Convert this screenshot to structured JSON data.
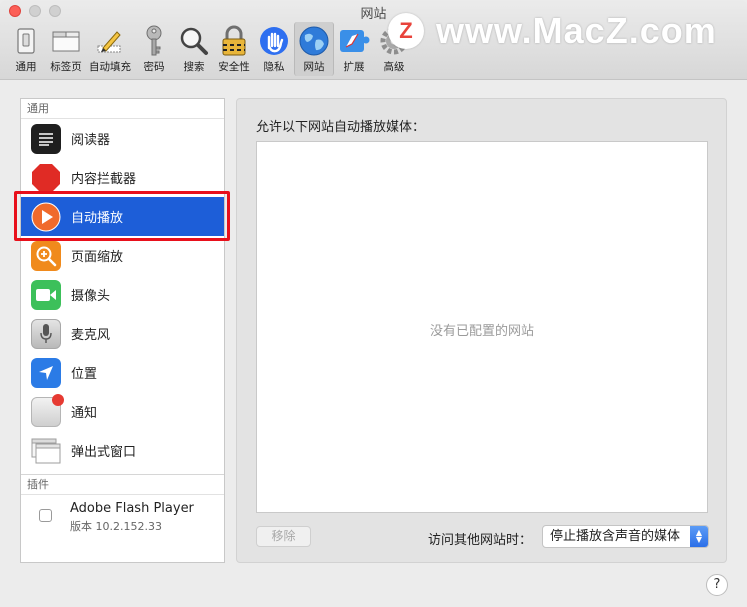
{
  "window": {
    "title": "网站"
  },
  "watermark": {
    "logo_letter": "Z",
    "text": "www.MacZ.com"
  },
  "toolbar": {
    "items": [
      {
        "label": "通用",
        "icon": "switch-icon"
      },
      {
        "label": "标签页",
        "icon": "tabs-icon"
      },
      {
        "label": "自动填充",
        "icon": "pencil-icon"
      },
      {
        "label": "密码",
        "icon": "key-icon"
      },
      {
        "label": "搜索",
        "icon": "magnifier-icon"
      },
      {
        "label": "安全性",
        "icon": "lock-icon"
      },
      {
        "label": "隐私",
        "icon": "hand-icon"
      },
      {
        "label": "网站",
        "icon": "globe-icon",
        "selected": true
      },
      {
        "label": "扩展",
        "icon": "puzzle-icon"
      },
      {
        "label": "高级",
        "icon": "gear-icon"
      }
    ]
  },
  "sidebar": {
    "general_header": "通用",
    "items": [
      {
        "label": "阅读器",
        "icon": "reader-icon"
      },
      {
        "label": "内容拦截器",
        "icon": "stop-sign-icon"
      },
      {
        "label": "自动播放",
        "icon": "play-icon",
        "selected": true
      },
      {
        "label": "页面缩放",
        "icon": "zoom-icon"
      },
      {
        "label": "摄像头",
        "icon": "camera-icon"
      },
      {
        "label": "麦克风",
        "icon": "microphone-icon"
      },
      {
        "label": "位置",
        "icon": "location-icon"
      },
      {
        "label": "通知",
        "icon": "notification-icon"
      },
      {
        "label": "弹出式窗口",
        "icon": "popup-window-icon"
      }
    ],
    "plugins_header": "插件",
    "plugins": [
      {
        "name": "Adobe Flash Player",
        "version": "版本 10.2.152.33",
        "checked": false
      }
    ]
  },
  "panel": {
    "title": "允许以下网站自动播放媒体：",
    "empty_text": "没有已配置的网站",
    "remove_label": "移除",
    "other_sites_label": "访问其他网站时：",
    "other_sites_value": "停止播放含声音的媒体"
  },
  "help": {
    "label": "?"
  },
  "colors": {
    "selection_blue": "#1d5ed8",
    "highlight_red": "#e8101b",
    "close_red": "#fc5f57"
  }
}
